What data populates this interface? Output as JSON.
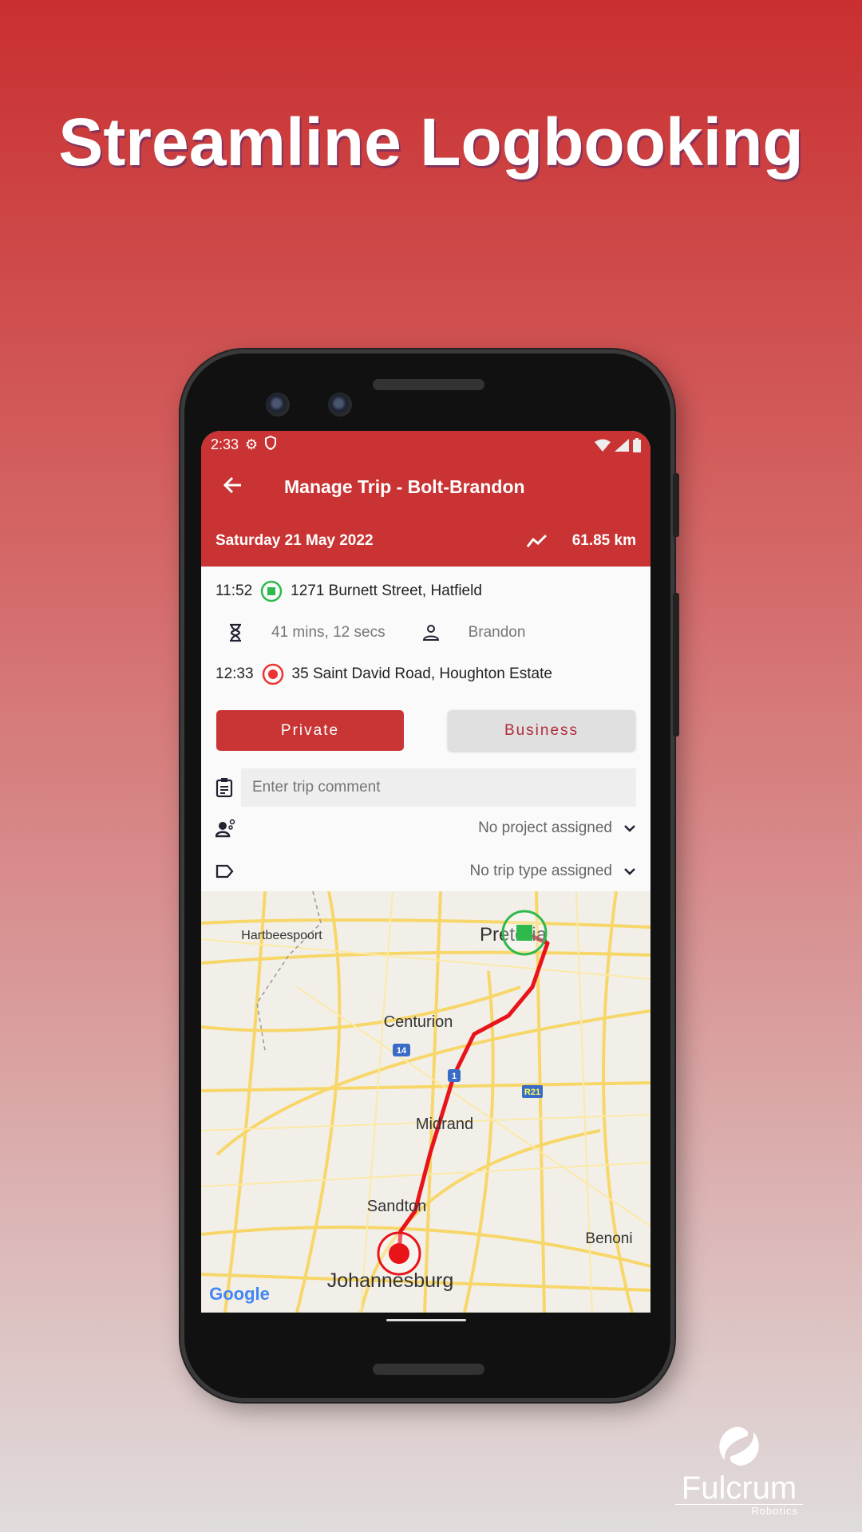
{
  "headline": "Streamline Logbooking",
  "status_bar": {
    "time": "2:33",
    "icons": [
      "gear-icon",
      "shield-icon",
      "wifi-icon",
      "signal-icon",
      "battery-icon"
    ]
  },
  "app": {
    "title": "Manage Trip - Bolt-Brandon",
    "date": "Saturday 21 May 2022",
    "distance": "61.85 km",
    "accent": "#c93333"
  },
  "trip": {
    "start": {
      "time": "11:52",
      "address": "1271 Burnett Street, Hatfield"
    },
    "duration": "41 mins, 12 secs",
    "driver": "Brandon",
    "end": {
      "time": "12:33",
      "address": "35 Saint David Road, Houghton Estate"
    }
  },
  "buttons": {
    "private": "Private",
    "business": "Business",
    "selected": "Private"
  },
  "comment": {
    "placeholder": "Enter trip comment",
    "value": ""
  },
  "project": {
    "value": "No project assigned"
  },
  "trip_type": {
    "value": "No trip type assigned"
  },
  "map": {
    "labels": {
      "hartbeespoort": "Hartbeespoort",
      "pretoria": "Pretoria",
      "centurion": "Centurion",
      "midrand": "Midrand",
      "sandton": "Sandton",
      "benoni": "Benoni",
      "johannesburg": "Johannesburg"
    },
    "shields": {
      "n14": "14",
      "n1": "1",
      "r21": "R21"
    },
    "attribution": "Google"
  },
  "logo": {
    "name": "Fulcrum",
    "sub": "Robotics"
  }
}
